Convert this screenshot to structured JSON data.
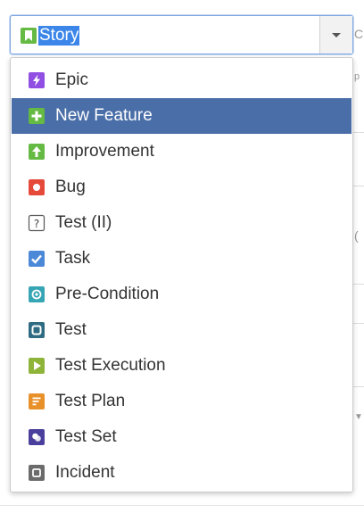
{
  "select": {
    "value": "Story",
    "icon": "story-icon",
    "accent": "#65ba43"
  },
  "options": [
    {
      "label": "Epic",
      "icon": "epic-icon",
      "color": "#904ee2"
    },
    {
      "label": "New Feature",
      "icon": "new-feature-icon",
      "color": "#65ba43",
      "selected": true
    },
    {
      "label": "Improvement",
      "icon": "improvement-icon",
      "color": "#65ba43"
    },
    {
      "label": "Bug",
      "icon": "bug-icon",
      "color": "#e5493a"
    },
    {
      "label": "Test (II)",
      "icon": "test-ii-icon",
      "color": "#ffffff"
    },
    {
      "label": "Task",
      "icon": "task-icon",
      "color": "#4bade8"
    },
    {
      "label": "Pre-Condition",
      "icon": "pre-condition-icon",
      "color": "#36a5b4"
    },
    {
      "label": "Test",
      "icon": "test-icon",
      "color": "#2f6b82"
    },
    {
      "label": "Test Execution",
      "icon": "test-execution-icon",
      "color": "#8fb43a"
    },
    {
      "label": "Test Plan",
      "icon": "test-plan-icon",
      "color": "#e8902a"
    },
    {
      "label": "Test Set",
      "icon": "test-set-icon",
      "color": "#4a3f9c"
    },
    {
      "label": "Incident",
      "icon": "incident-icon",
      "color": "#6b6b6b"
    }
  ],
  "colors": {
    "highlight": "#4a6ea8",
    "focus_border": "#7ea6e0",
    "text_selection": "#3b86e8"
  }
}
